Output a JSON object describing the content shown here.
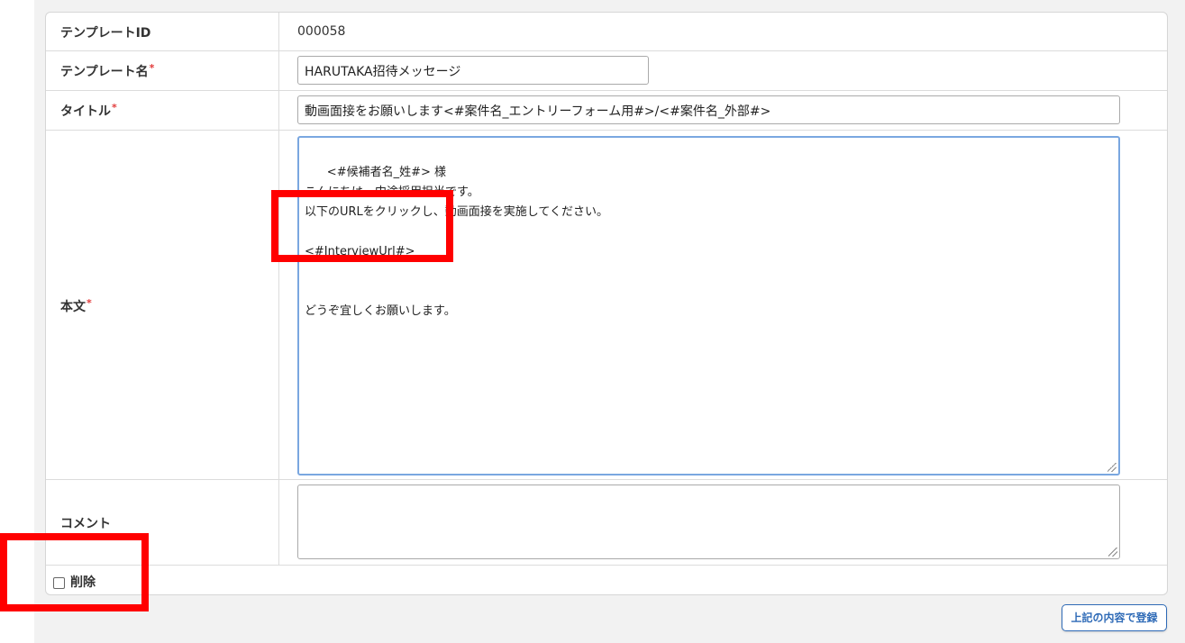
{
  "form": {
    "template_id_label": "テンプレートID",
    "template_id_value": "000058",
    "template_name_label": "テンプレート名",
    "template_name_value": "HARUTAKA招待メッセージ",
    "title_label": "タイトル",
    "title_value": "動画面接をお願いします<#案件名_エントリーフォーム用#>/<#案件名_外部#>",
    "body_label": "本文",
    "body_value": "<#候補者名_姓#> 様\nこんにちは。中途採用担当です。\n以下のURLをクリックし、動画面接を実施してください。\n\n<#InterviewUrl#>\n\n\nどうぞ宜しくお願いします。",
    "comment_label": "コメント",
    "comment_value": "",
    "required_mark": "*",
    "delete_label": "削除",
    "delete_checked": false
  },
  "actions": {
    "submit_label": "上記の内容で登録"
  },
  "colors": {
    "required": "#e23b3b",
    "highlight": "#ff0000",
    "button_accent": "#2f6bb7",
    "focus_border": "#7aa7e0"
  }
}
